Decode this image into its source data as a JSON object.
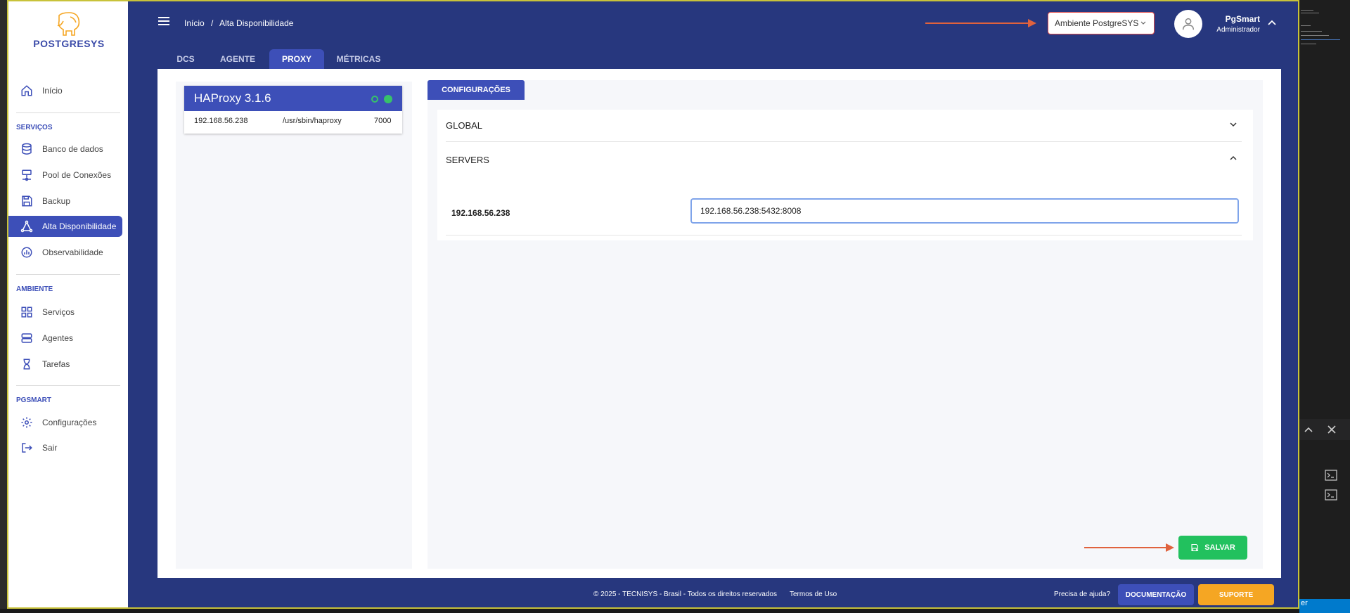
{
  "app": {
    "logo_text": "POSTGRESYS"
  },
  "sidebar": {
    "items": [
      {
        "label": "Início"
      },
      {
        "label": "Banco de dados"
      },
      {
        "label": "Pool de Conexões"
      },
      {
        "label": "Backup"
      },
      {
        "label": "Alta Disponibilidade"
      },
      {
        "label": "Observabilidade"
      },
      {
        "label": "Serviços"
      },
      {
        "label": "Agentes"
      },
      {
        "label": "Tarefas"
      },
      {
        "label": "Configurações"
      },
      {
        "label": "Sair"
      }
    ],
    "sections": {
      "servicos": "SERVIÇOS",
      "ambiente": "AMBIENTE",
      "pgsmart": "PGSMART"
    }
  },
  "header": {
    "breadcrumb": [
      "Início",
      "/",
      "Alta Disponibilidade"
    ],
    "environment": "Ambiente PostgreSYS",
    "user_name": "PgSmart",
    "user_role": "Administrador"
  },
  "tabs": [
    {
      "label": "DCS"
    },
    {
      "label": "AGENTE"
    },
    {
      "label": "PROXY"
    },
    {
      "label": "MÉTRICAS"
    }
  ],
  "proxy": {
    "name": "HAProxy 3.1.6",
    "ip": "192.168.56.238",
    "path": "/usr/sbin/haproxy",
    "port": "7000"
  },
  "config": {
    "tab_label": "CONFIGURAÇÕES",
    "sections": [
      {
        "label": "GLOBAL"
      },
      {
        "label": "SERVERS"
      }
    ],
    "server_name": "192.168.56.238",
    "server_value": "192.168.56.238:5432:8008",
    "save_label": "SALVAR"
  },
  "footer": {
    "copyright": "© 2025 - TECNISYS - Brasil - Todos os direitos reservados",
    "terms": "Termos de Uso",
    "help": "Precisa de ajuda?",
    "doc_label": "DOCUMENTAÇÃO",
    "support_label": "SUPORTE"
  },
  "editor": {
    "status_text": "er"
  },
  "colors": {
    "primary": "#3d4fb8",
    "background": "#27377e",
    "success": "#22c15e",
    "warning": "#f5a623",
    "annotation": "#e0623d"
  }
}
